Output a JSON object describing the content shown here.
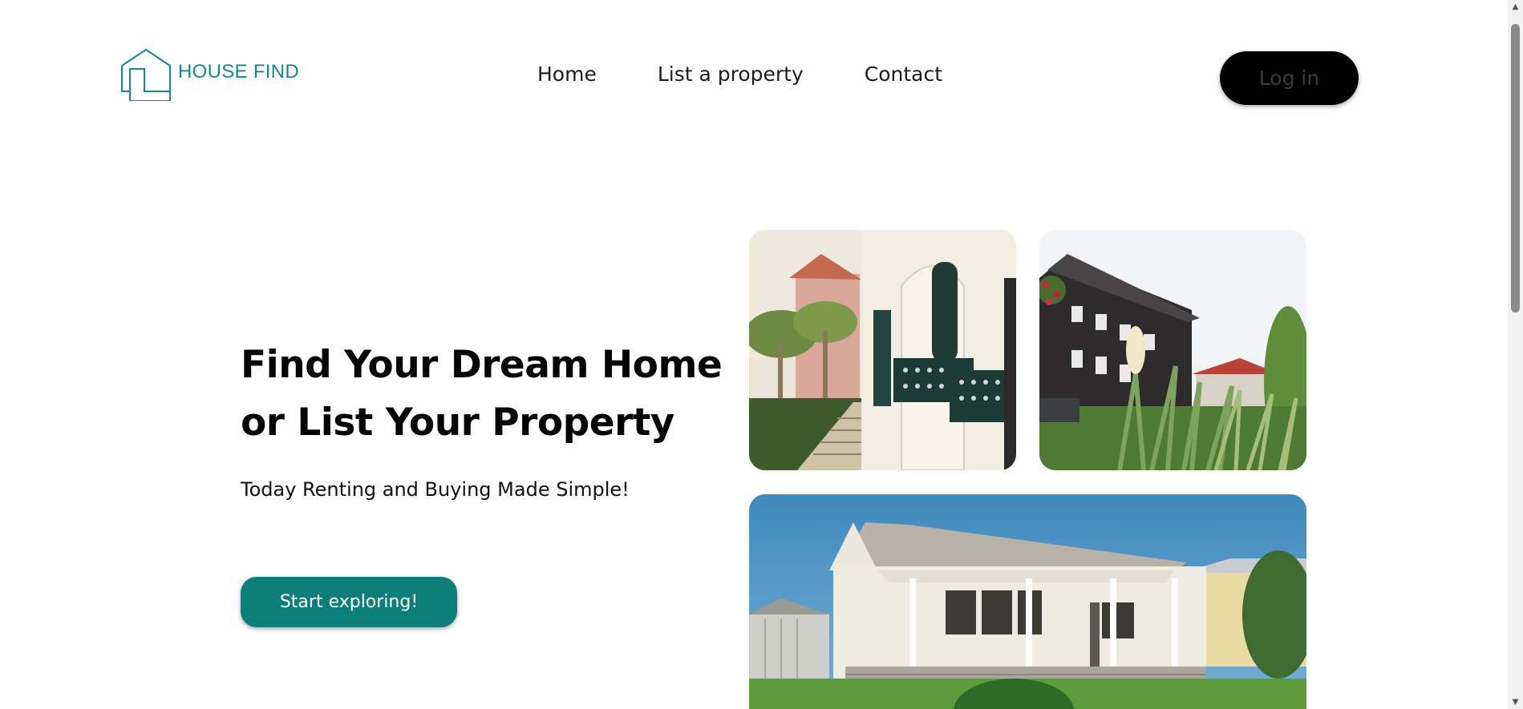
{
  "brand": {
    "name": "HOUSE FIND",
    "logo_icon": "house-outline-icon",
    "color": "#12898a"
  },
  "nav": {
    "items": [
      {
        "label": "Home"
      },
      {
        "label": "List a property"
      },
      {
        "label": "Contact"
      }
    ]
  },
  "header": {
    "login_label": "Log in"
  },
  "hero": {
    "title_line1": "Find Your Dream Home",
    "title_line2": "or List Your Property",
    "subtitle": "Today Renting and Buying Made Simple!",
    "cta_label": "Start exploring!",
    "cta_color": "#0d7f7a"
  },
  "gallery": {
    "images": [
      {
        "name": "white-villa-balcony-photo"
      },
      {
        "name": "dark-wood-house-garden-photo"
      },
      {
        "name": "white-cottage-lawn-photo"
      }
    ]
  },
  "scrollbar": {
    "up_icon": "scroll-up-arrow-icon",
    "down_icon": "scroll-down-arrow-icon"
  }
}
